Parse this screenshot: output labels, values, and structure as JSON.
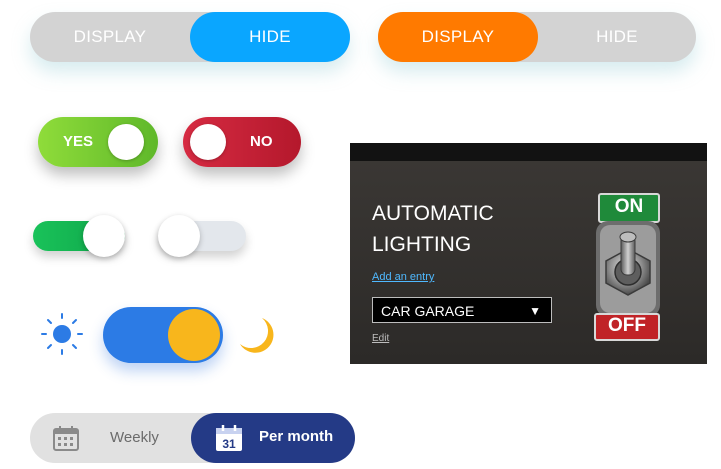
{
  "toggle_display_hide_1": {
    "display_label": "DISPLAY",
    "hide_label": "HIDE",
    "selected": "HIDE",
    "accent": "#0aa6ff"
  },
  "toggle_display_hide_2": {
    "display_label": "DISPLAY",
    "hide_label": "HIDE",
    "selected": "DISPLAY",
    "accent": "#ff7a00"
  },
  "yes_toggle": {
    "label": "YES",
    "state": "on",
    "color": "#7ccf2b"
  },
  "no_toggle": {
    "label": "NO",
    "state": "off",
    "color": "#c61f36"
  },
  "switch_on": {
    "state": "on",
    "color": "#12b04d"
  },
  "switch_off": {
    "state": "off",
    "color": "#dfe3e8"
  },
  "day_night_toggle": {
    "state": "night",
    "sun_color": "#2c7be5",
    "moon_color": "#f8b61c"
  },
  "period_toggle": {
    "weekly_label": "Weekly",
    "per_month_label": "Per month",
    "calendar_day": "31",
    "selected": "Per month"
  },
  "lighting_panel": {
    "title": "AUTOMATIC\nLIGHTING",
    "add_entry_link": "Add an entry",
    "select_value": "CAR GARAGE",
    "edit_link": "Edit",
    "switch_on_label": "ON",
    "switch_off_label": "OFF"
  }
}
